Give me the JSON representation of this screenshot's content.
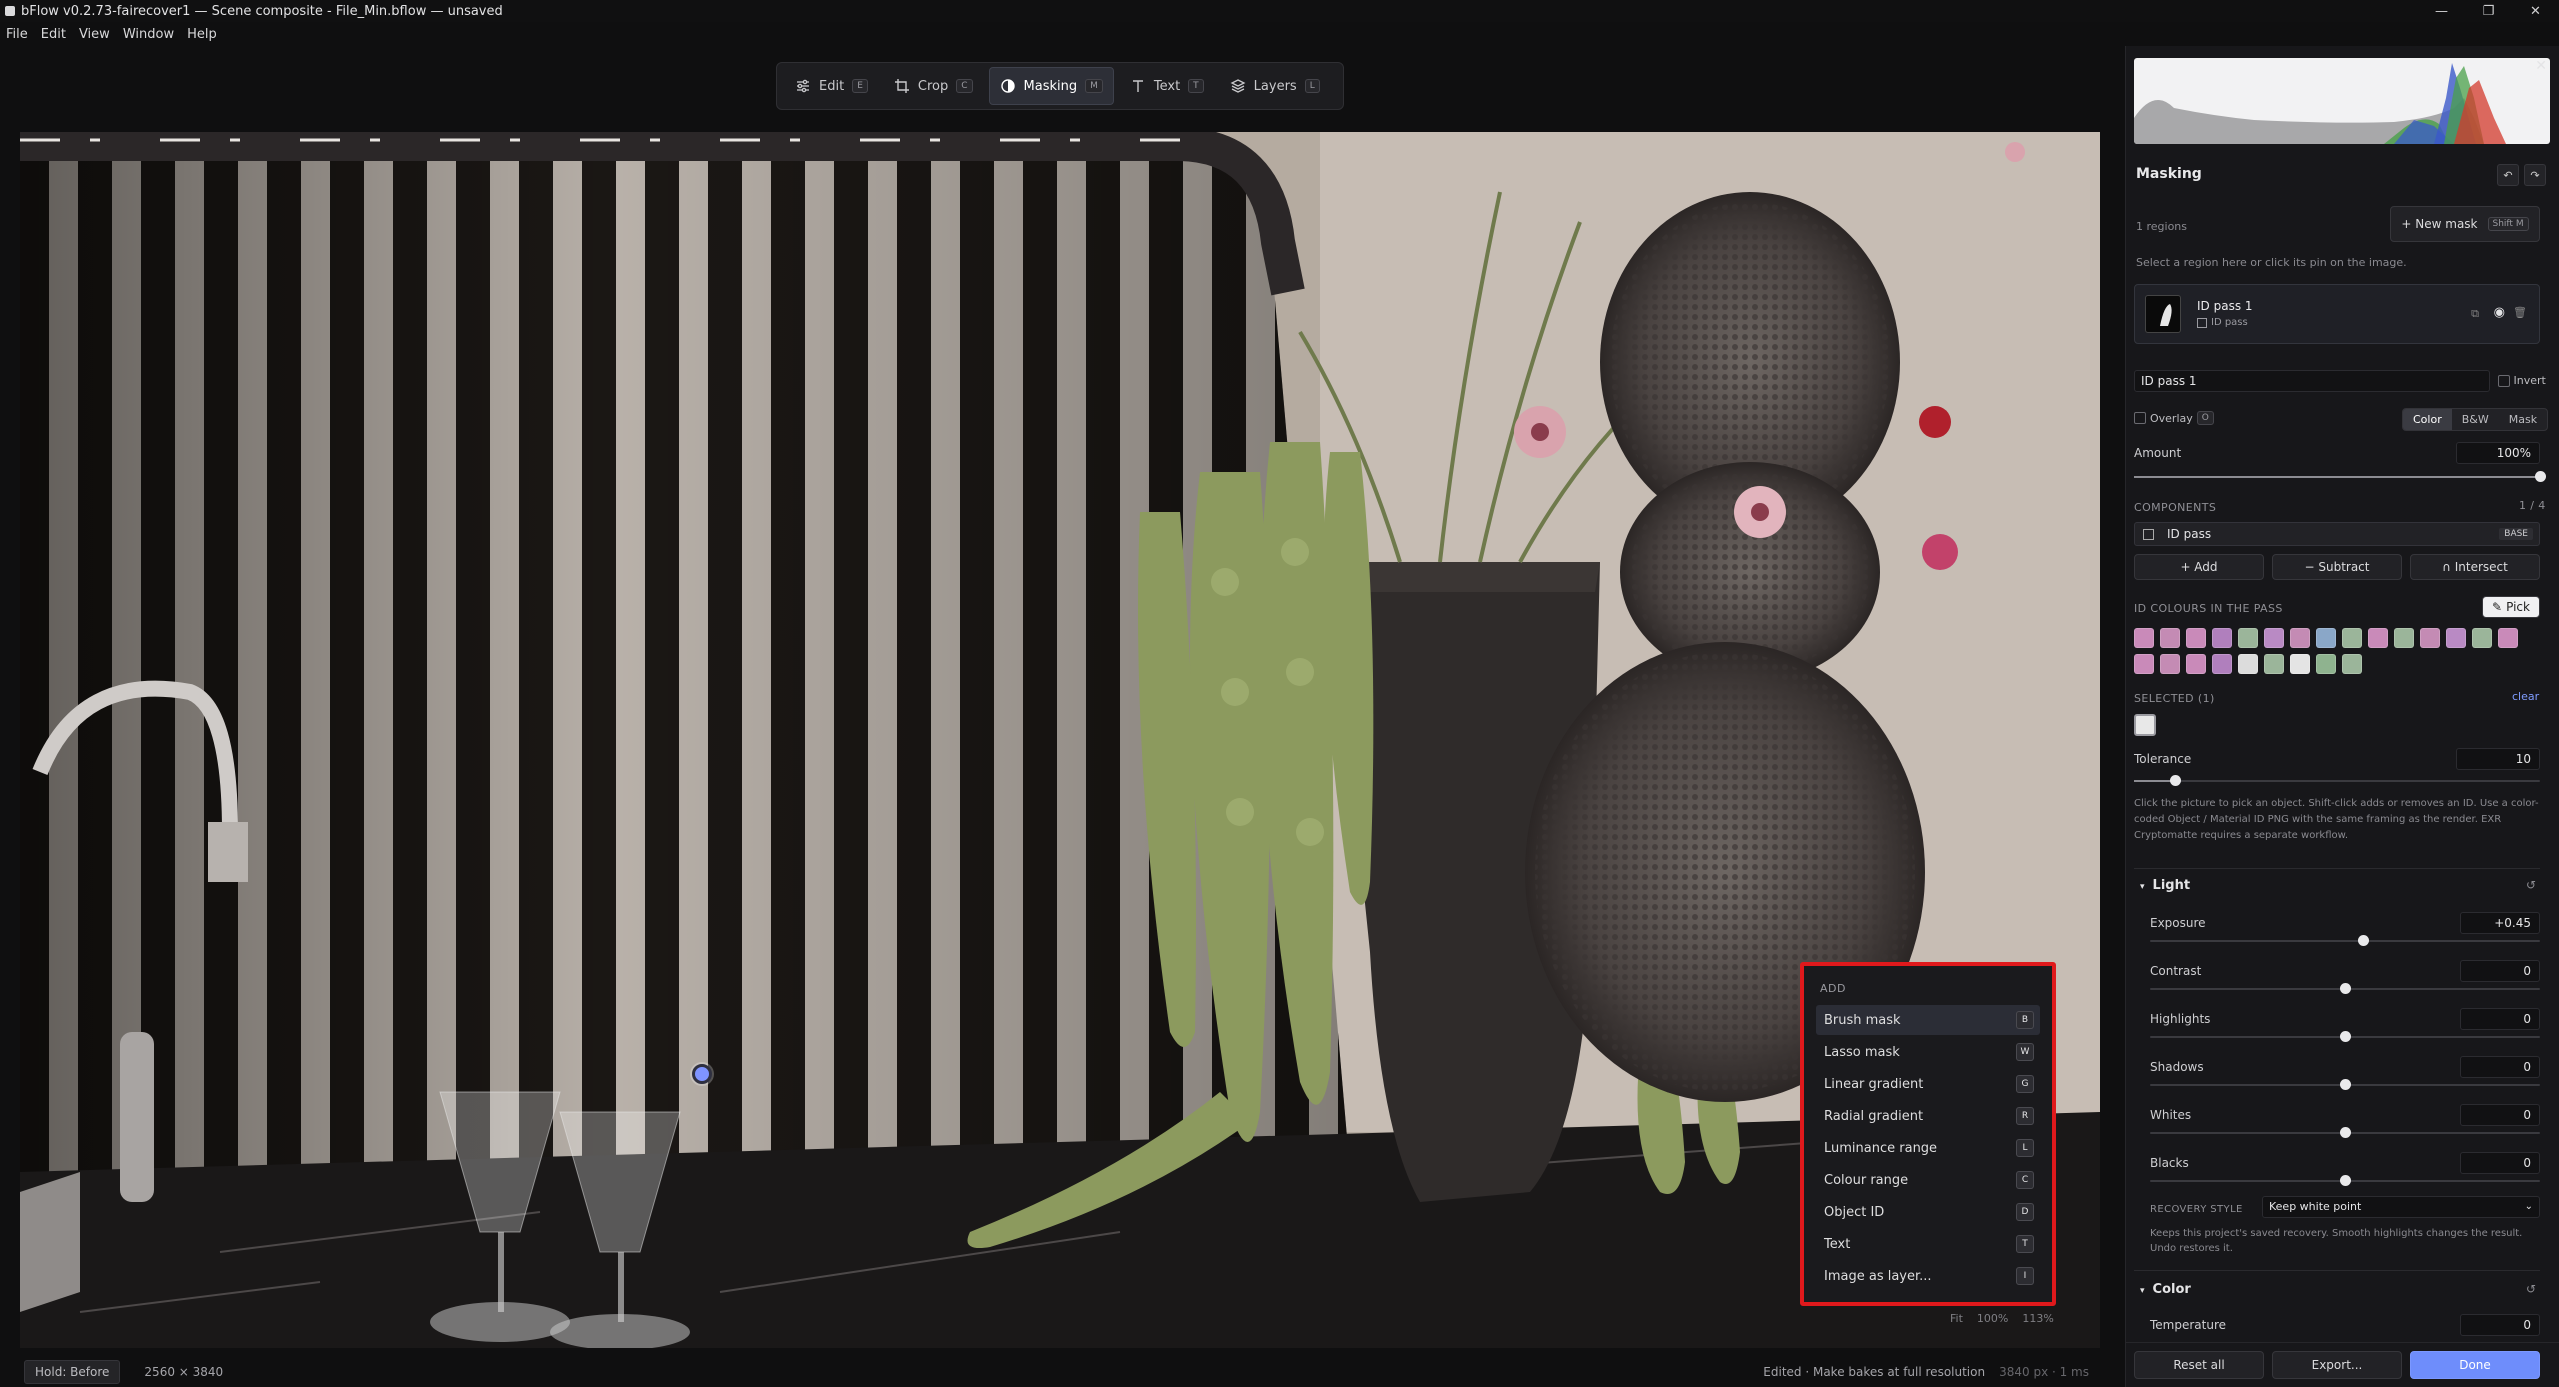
{
  "window": {
    "title": "bFlow v0.2.73-fairecover1 — Scene composite - File_Min.bflow — unsaved",
    "controls": [
      "—",
      "❐",
      "✕"
    ]
  },
  "menu": [
    "File",
    "Edit",
    "View",
    "Window",
    "Help"
  ],
  "toolbar": [
    {
      "label": "Edit",
      "key": "E",
      "icon": "sliders-icon"
    },
    {
      "label": "Crop",
      "key": "C",
      "icon": "crop-icon"
    },
    {
      "label": "Masking",
      "key": "M",
      "icon": "half-circle-icon",
      "active": true
    },
    {
      "label": "Text",
      "key": "T",
      "icon": "text-icon"
    },
    {
      "label": "Layers",
      "key": "L",
      "icon": "layers-icon"
    }
  ],
  "add_menu": {
    "header": "ADD",
    "items": [
      {
        "label": "Brush mask",
        "key": "B",
        "highlighted": true
      },
      {
        "label": "Lasso mask",
        "key": "W"
      },
      {
        "label": "Linear gradient",
        "key": "G"
      },
      {
        "label": "Radial gradient",
        "key": "R"
      },
      {
        "label": "Luminance range",
        "key": "L"
      },
      {
        "label": "Colour range",
        "key": "C"
      },
      {
        "label": "Object ID",
        "key": "D"
      },
      {
        "label": "Text",
        "key": "T"
      },
      {
        "label": "Image as layer...",
        "key": "I"
      }
    ]
  },
  "zoom": {
    "fit": "Fit",
    "z100": "100%",
    "z113": "113%"
  },
  "status": {
    "hold": "Hold: Before",
    "dims": "2560 × 3840",
    "edited": "Edited · Make bakes at full resolution",
    "px": "3840 px · 1 ms"
  },
  "panel": {
    "title": "Masking",
    "undo": "↶",
    "redo": "↷",
    "regions": "1 regions",
    "new_mask": "+ New mask",
    "new_mask_key": "Shift M",
    "hint": "Select a region here or click its pin on the image.",
    "mask_item": {
      "name": "ID pass 1",
      "sub": "ID pass"
    },
    "name_value": "ID pass 1",
    "invert": "Invert",
    "overlay": "Overlay",
    "overlay_key": "O",
    "modes": [
      "Color",
      "B&W",
      "Mask"
    ],
    "amount_label": "Amount",
    "amount_value": "100%",
    "amount": 1.0,
    "components_label": "COMPONENTS",
    "components_count": "1 / 4",
    "component": {
      "name": "ID pass",
      "tag": "BASE"
    },
    "ops": [
      "+ Add",
      "− Subtract",
      "∩ Intersect"
    ],
    "id_colours_label": "ID COLOURS IN THE PASS",
    "pick": "Pick",
    "swatches_row1": [
      "#c98ab9",
      "#c48bb4",
      "#c98ab9",
      "#b07fbd",
      "#9bb59a",
      "#b98ac4",
      "#c48bb4",
      "#8aa7c8",
      "#9bb59a",
      "#c98ab9",
      "#9bb59a",
      "#c48bb4",
      "#b98ac4",
      "#9bb59a",
      "#c98ab9"
    ],
    "swatches_row2": [
      "#c98ab9",
      "#c48bb4",
      "#c98ab9",
      "#b07fbd",
      "#dcdcdc",
      "#9bb59a",
      "#e4e4e4",
      "#8fb38f",
      "#9bb59a"
    ],
    "selected_label": "SELECTED (1)",
    "clear": "clear",
    "selected_swatch": "#e8e8e8",
    "tolerance_label": "Tolerance",
    "tolerance_value": "10",
    "tolerance": 0.1,
    "pick_help": "Click the picture to pick an object. Shift-click adds or removes an ID. Use a color-coded Object / Material ID PNG with the same framing as the render. EXR Cryptomatte requires a separate workflow.",
    "light": {
      "title": "Light",
      "reset": "↺",
      "sliders": [
        {
          "label": "Exposure",
          "value": "+0.45",
          "pos": 0.545
        },
        {
          "label": "Contrast",
          "value": "0",
          "pos": 0.5
        },
        {
          "label": "Highlights",
          "value": "0",
          "pos": 0.5
        },
        {
          "label": "Shadows",
          "value": "0",
          "pos": 0.5
        },
        {
          "label": "Whites",
          "value": "0",
          "pos": 0.5
        },
        {
          "label": "Blacks",
          "value": "0",
          "pos": 0.5
        }
      ]
    },
    "recovery_label": "RECOVERY STYLE",
    "recovery_value": "Keep white point",
    "recovery_help": "Keeps this project's saved recovery. Smooth highlights changes the result. Undo restores it.",
    "color": {
      "title": "Color",
      "reset": "↺",
      "temp_label": "Temperature",
      "temp_value": "0"
    },
    "footer": {
      "reset": "Reset all",
      "export": "Export...",
      "done": "Done"
    }
  }
}
